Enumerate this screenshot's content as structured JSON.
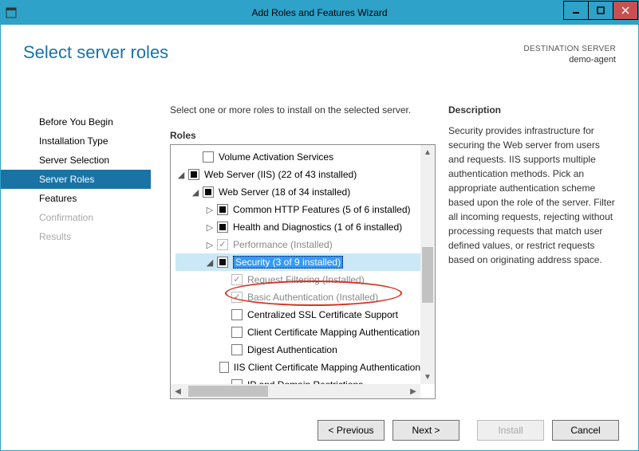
{
  "window": {
    "title": "Add Roles and Features Wizard"
  },
  "header": {
    "page_title": "Select server roles",
    "destination_label": "DESTINATION SERVER",
    "destination_name": "demo-agent"
  },
  "nav": {
    "items": [
      {
        "label": "Before You Begin",
        "state": "normal"
      },
      {
        "label": "Installation Type",
        "state": "normal"
      },
      {
        "label": "Server Selection",
        "state": "normal"
      },
      {
        "label": "Server Roles",
        "state": "selected"
      },
      {
        "label": "Features",
        "state": "normal"
      },
      {
        "label": "Confirmation",
        "state": "disabled"
      },
      {
        "label": "Results",
        "state": "disabled"
      }
    ]
  },
  "main": {
    "intro": "Select one or more roles to install on the selected server.",
    "roles_label": "Roles",
    "tree": [
      {
        "indent": 1,
        "expander": "",
        "check": "empty",
        "label": "Volume Activation Services",
        "grey": false,
        "selected": false
      },
      {
        "indent": 0,
        "expander": "open",
        "check": "partial",
        "label": "Web Server (IIS) (22 of 43 installed)",
        "grey": false,
        "selected": false
      },
      {
        "indent": 1,
        "expander": "open",
        "check": "partial",
        "label": "Web Server (18 of 34 installed)",
        "grey": false,
        "selected": false
      },
      {
        "indent": 2,
        "expander": "closed",
        "check": "partial",
        "label": "Common HTTP Features (5 of 6 installed)",
        "grey": false,
        "selected": false
      },
      {
        "indent": 2,
        "expander": "closed",
        "check": "partial",
        "label": "Health and Diagnostics (1 of 6 installed)",
        "grey": false,
        "selected": false
      },
      {
        "indent": 2,
        "expander": "closed",
        "check": "checked",
        "label": "Performance (Installed)",
        "grey": true,
        "selected": false
      },
      {
        "indent": 2,
        "expander": "open",
        "check": "partial",
        "label": "Security (3 of 9 installed)",
        "grey": false,
        "selected": true
      },
      {
        "indent": 3,
        "expander": "",
        "check": "checked",
        "label": "Request Filtering (Installed)",
        "grey": true,
        "selected": false
      },
      {
        "indent": 3,
        "expander": "",
        "check": "checked",
        "label": "Basic Authentication (Installed)",
        "grey": true,
        "selected": false
      },
      {
        "indent": 3,
        "expander": "",
        "check": "empty",
        "label": "Centralized SSL Certificate Support",
        "grey": false,
        "selected": false
      },
      {
        "indent": 3,
        "expander": "",
        "check": "empty",
        "label": "Client Certificate Mapping Authentication",
        "grey": false,
        "selected": false
      },
      {
        "indent": 3,
        "expander": "",
        "check": "empty",
        "label": "Digest Authentication",
        "grey": false,
        "selected": false
      },
      {
        "indent": 3,
        "expander": "",
        "check": "empty",
        "label": "IIS Client Certificate Mapping Authentication",
        "grey": false,
        "selected": false
      },
      {
        "indent": 3,
        "expander": "",
        "check": "empty",
        "label": "IP and Domain Restrictions",
        "grey": false,
        "selected": false
      }
    ]
  },
  "description": {
    "label": "Description",
    "text": "Security provides infrastructure for securing the Web server from users and requests. IIS supports multiple authentication methods. Pick an appropriate authentication scheme based upon the role of the server. Filter all incoming requests, rejecting without processing requests that match user defined values, or restrict requests based on originating address space."
  },
  "footer": {
    "previous": "< Previous",
    "next": "Next >",
    "install": "Install",
    "cancel": "Cancel"
  }
}
